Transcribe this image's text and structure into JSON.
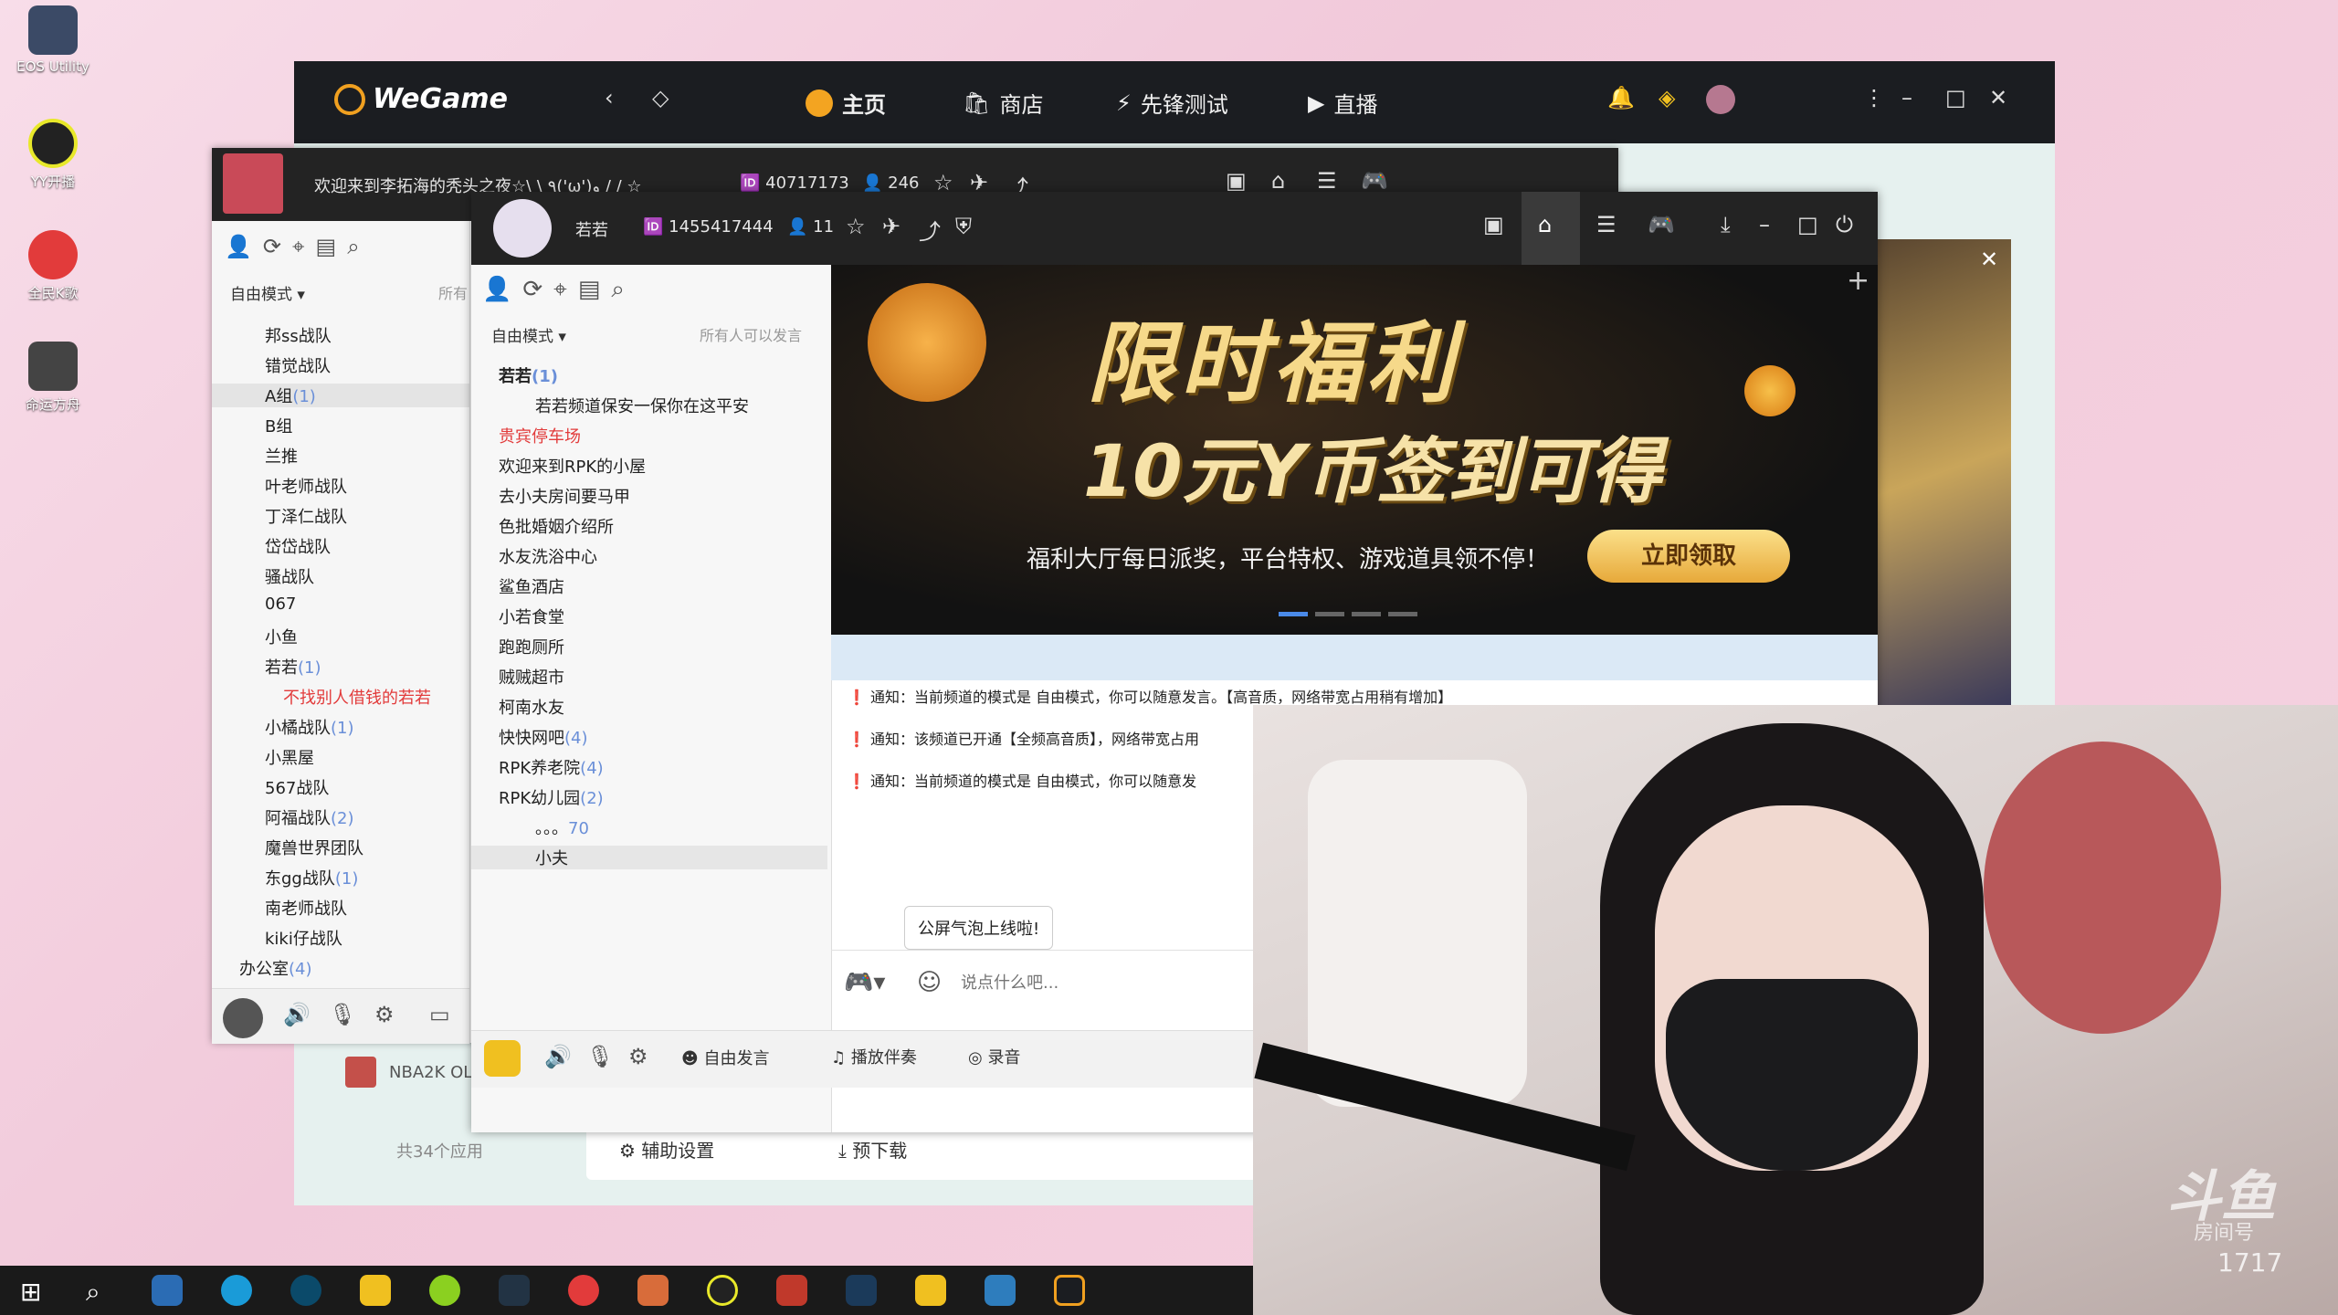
{
  "desktop": {
    "icons": [
      {
        "label": "EOS Utility",
        "icon": "camera-icon"
      },
      {
        "label": "YY开播",
        "icon": "yy-live-icon"
      },
      {
        "label": "全民K歌",
        "icon": "karaoke-icon"
      },
      {
        "label": "命运方舟",
        "icon": "lost-ark-icon"
      }
    ]
  },
  "wegame": {
    "logo": "WeGame",
    "tabs": [
      "主页",
      "商店",
      "先锋测试",
      "直播"
    ],
    "sidebar_label": "NBA2K OL",
    "app_count": "共34个应用",
    "bottom_buttons": [
      "辅助设置",
      "预下载"
    ]
  },
  "yy1": {
    "title": "欢迎来到李拓海的秃头之夜☆\\ \\ ٩('ω')و / / ☆",
    "channel_id": "40717173",
    "online": "246",
    "mode": "自由模式",
    "mode_right": "所有",
    "tree": [
      {
        "label": "邦ss战队",
        "count": ""
      },
      {
        "label": "错觉战队",
        "count": ""
      },
      {
        "label": "A组",
        "count": "(1)"
      },
      {
        "label": "B组",
        "count": ""
      },
      {
        "label": "兰推",
        "count": ""
      },
      {
        "label": "叶老师战队",
        "count": ""
      },
      {
        "label": "丁泽仁战队",
        "count": ""
      },
      {
        "label": "岱岱战队",
        "count": ""
      },
      {
        "label": "骚战队",
        "count": ""
      },
      {
        "label": "067",
        "count": ""
      },
      {
        "label": "小鱼",
        "count": ""
      },
      {
        "label": "若若",
        "count": "(1)"
      },
      {
        "label": "不找别人借钱的若若",
        "count": ""
      },
      {
        "label": "小橘战队",
        "count": "(1)"
      },
      {
        "label": "小黑屋",
        "count": ""
      },
      {
        "label": "567战队",
        "count": ""
      },
      {
        "label": "阿福战队",
        "count": "(2)"
      },
      {
        "label": "魔兽世界团队",
        "count": ""
      },
      {
        "label": "东gg战队",
        "count": "(1)"
      },
      {
        "label": "南老师战队",
        "count": ""
      },
      {
        "label": "kiki仔战队",
        "count": ""
      },
      {
        "label": "办公室",
        "count": "(4)"
      }
    ]
  },
  "yy2": {
    "title": "若若",
    "channel_id": "1455417444",
    "online": "11",
    "mode": "自由模式",
    "mode_right": "所有人可以发言",
    "channels": [
      {
        "label": "若若",
        "count": "(1)",
        "style": "bold"
      },
      {
        "label": "若若频道保安一保你在这平安",
        "count": "",
        "style": "user"
      },
      {
        "label": "贵宾停车场",
        "count": "",
        "style": "red"
      },
      {
        "label": "欢迎来到RPK的小屋",
        "count": "",
        "style": ""
      },
      {
        "label": "去小夫房间要马甲",
        "count": "",
        "style": ""
      },
      {
        "label": "色批婚姻介绍所",
        "count": "",
        "style": ""
      },
      {
        "label": "水友洗浴中心",
        "count": "",
        "style": ""
      },
      {
        "label": "鲨鱼酒店",
        "count": "",
        "style": ""
      },
      {
        "label": "小若食堂",
        "count": "",
        "style": ""
      },
      {
        "label": "跑跑厕所",
        "count": "",
        "style": ""
      },
      {
        "label": "贼贼超市",
        "count": "",
        "style": ""
      },
      {
        "label": "柯南水友",
        "count": "",
        "style": ""
      },
      {
        "label": "快快网吧",
        "count": "(4)",
        "style": ""
      },
      {
        "label": "RPK养老院",
        "count": "(4)",
        "style": ""
      },
      {
        "label": "RPK幼儿园",
        "count": "(2)",
        "style": ""
      },
      {
        "label": "。。。",
        "count": "70",
        "style": "user"
      },
      {
        "label": "小夫",
        "count": "",
        "style": "user-selected"
      }
    ],
    "banner": {
      "title": "限时福利",
      "subtitle": "10元Y币签到可得",
      "desc": "福利大厅每日派奖，平台特权、游戏道具领不停！",
      "button": "立即领取"
    },
    "notices": [
      "通知：当前频道的模式是 自由模式，你可以随意发言。【高音质，网络带宽占用稍有增加】",
      "通知：该频道已开通【全频高音质】，网络带宽占用",
      "通知：当前频道的模式是 自由模式，你可以随意发"
    ],
    "tooltip": "公屏气泡上线啦!",
    "input_placeholder": "说点什么吧...",
    "bottom": [
      "自由发言",
      "播放伴奏",
      "录音"
    ]
  },
  "stream": {
    "watermark": "斗鱼",
    "room_label": "房间号",
    "room_id": "1717"
  },
  "colors": {
    "accent_red": "#e23b3b",
    "titlebar": "#232323",
    "banner_gold": "#f3c34a"
  }
}
